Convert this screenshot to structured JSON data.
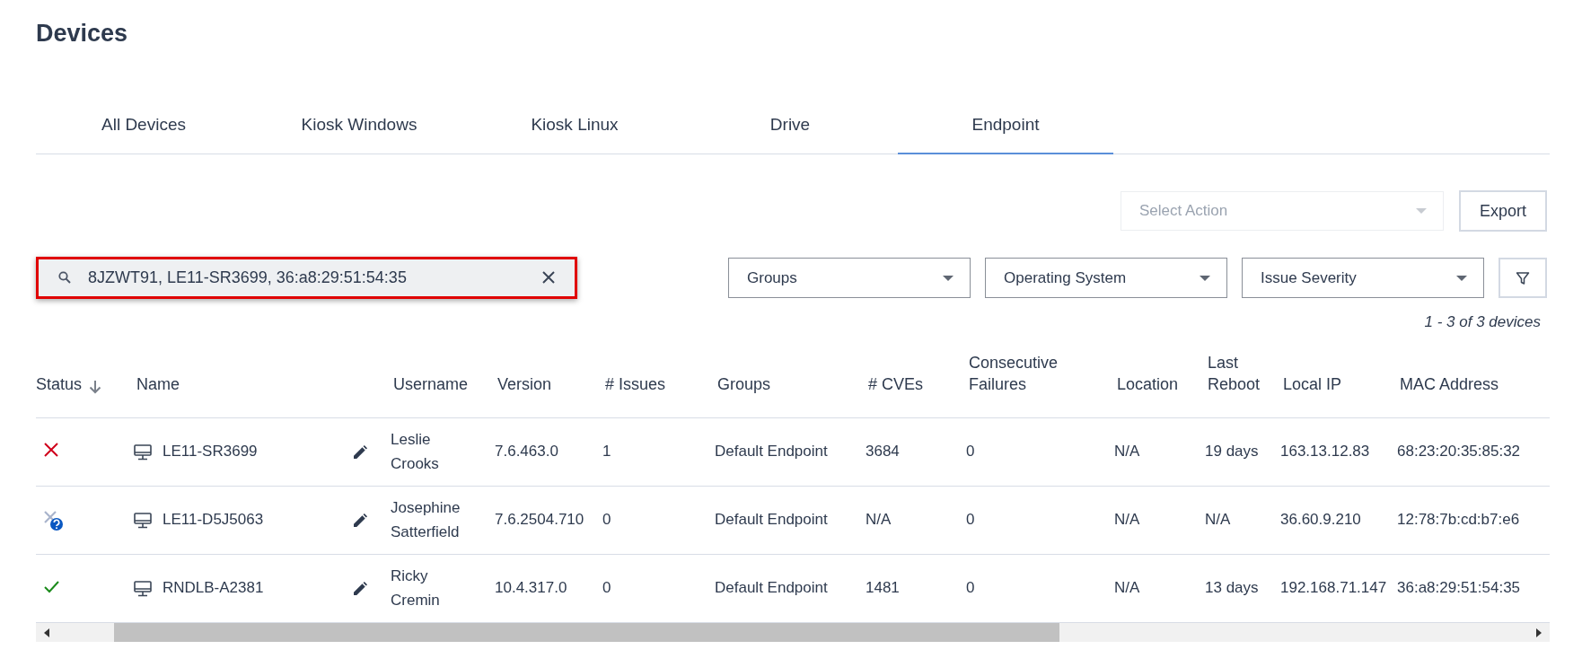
{
  "page": {
    "title": "Devices"
  },
  "tabs": [
    {
      "label": "All Devices",
      "selected": false
    },
    {
      "label": "Kiosk Windows",
      "selected": false
    },
    {
      "label": "Kiosk Linux",
      "selected": false
    },
    {
      "label": "Drive",
      "selected": false
    },
    {
      "label": "Endpoint",
      "selected": true
    }
  ],
  "actions": {
    "select_action": {
      "placeholder": "Select Action",
      "disabled": true
    },
    "export_button": "Export"
  },
  "search": {
    "value": "8JZWT91, LE11-SR3699, 36:a8:29:51:54:35",
    "highlighted": true
  },
  "filters": [
    {
      "label": "Groups"
    },
    {
      "label": "Operating System"
    },
    {
      "label": "Issue Severity"
    }
  ],
  "result_count": "1 - 3 of 3 devices",
  "table": {
    "columns": [
      {
        "label": "Status",
        "sorted": true
      },
      {
        "label": "Name",
        "sorted": false
      },
      {
        "label": "Username",
        "sorted": false
      },
      {
        "label": "Version",
        "sorted": false
      },
      {
        "label": "# Issues",
        "sorted": false
      },
      {
        "label": "Groups",
        "sorted": false
      },
      {
        "label": "# CVEs",
        "sorted": false
      },
      {
        "label": "Consecutive Failures",
        "sorted": false
      },
      {
        "label": "Location",
        "sorted": false
      },
      {
        "label": "Last Reboot",
        "sorted": false
      },
      {
        "label": "Local IP",
        "sorted": false
      },
      {
        "label": "MAC Address",
        "sorted": false
      }
    ],
    "rows": [
      {
        "kind": "error",
        "name": "LE11-SR3699",
        "username": "Leslie Crooks",
        "version": "7.6.463.0",
        "issues": "1",
        "groups": "Default Endpoint",
        "cves": "3684",
        "consecutive_failures": "0",
        "location": "N/A",
        "last_reboot": "19 days",
        "local_ip": "163.13.12.83",
        "mac_address": "68:23:20:35:85:32"
      },
      {
        "kind": "unknown",
        "name": "LE11-D5J5063",
        "username": "Josephine Satterfield",
        "version": "7.6.2504.710",
        "issues": "0",
        "groups": "Default Endpoint",
        "cves": "N/A",
        "consecutive_failures": "0",
        "location": "N/A",
        "last_reboot": "N/A",
        "local_ip": "36.60.9.210",
        "mac_address": "12:78:7b:cd:b7:e6"
      },
      {
        "kind": "ok",
        "name": "RNDLB-A2381",
        "username": "Ricky Cremin",
        "version": "10.4.317.0",
        "issues": "0",
        "groups": "Default Endpoint",
        "cves": "1481",
        "consecutive_failures": "0",
        "location": "N/A",
        "last_reboot": "13 days",
        "local_ip": "192.168.71.147",
        "mac_address": "36:a8:29:51:54:35"
      }
    ]
  }
}
